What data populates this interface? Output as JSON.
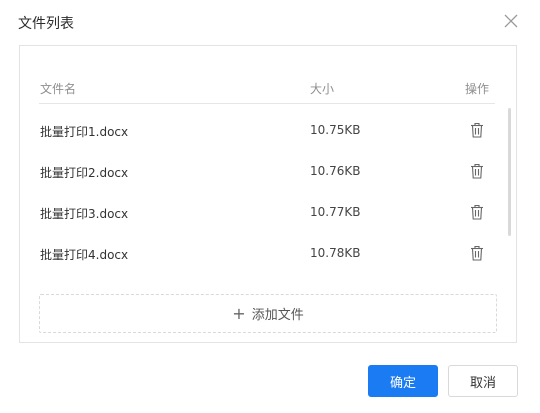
{
  "dialog": {
    "title": "文件列表"
  },
  "table": {
    "headers": {
      "name": "文件名",
      "size": "大小",
      "action": "操作"
    },
    "rows": [
      {
        "name": "批量打印1.docx",
        "size": "10.75KB"
      },
      {
        "name": "批量打印2.docx",
        "size": "10.76KB"
      },
      {
        "name": "批量打印3.docx",
        "size": "10.77KB"
      },
      {
        "name": "批量打印4.docx",
        "size": "10.78KB"
      }
    ],
    "row_action_icon": "trash-icon"
  },
  "add_file": {
    "label": "添加文件",
    "icon": "plus-icon"
  },
  "footer": {
    "ok_label": "确定",
    "cancel_label": "取消"
  },
  "colors": {
    "primary": "#1a7bf2"
  }
}
